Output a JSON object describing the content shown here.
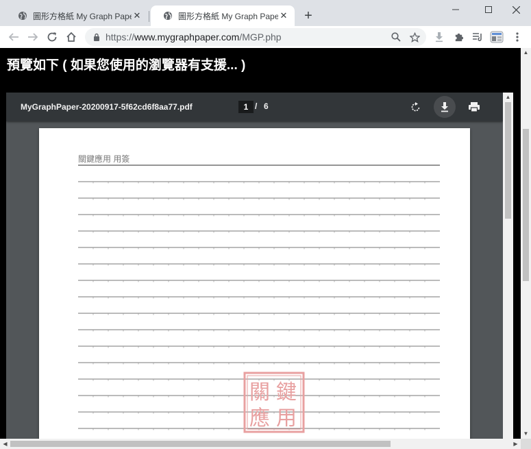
{
  "browser": {
    "tabs": [
      {
        "label": "圖形方格紙 My Graph Paper",
        "active": false
      },
      {
        "label": "圖形方格紙 My Graph Paper - P",
        "active": true
      }
    ],
    "url_scheme": "https://",
    "url_host": "www.mygraphpaper.com",
    "url_path": "/MGP.php",
    "accent": "#dee1e6"
  },
  "page": {
    "heading": "預覽如下 ( 如果您使用的瀏覽器有支援... )"
  },
  "viewer": {
    "file_name": "MyGraphPaper-20200917-5f62cd6f8aa77.pdf",
    "current_page": "1",
    "separator": "/",
    "total_pages": "6",
    "paper": {
      "title": "關鍵應用 用簽",
      "line_count": 17,
      "seal_chars": [
        "關",
        "鍵",
        "應",
        "用"
      ],
      "seal_color": "#e8a0a0"
    }
  }
}
